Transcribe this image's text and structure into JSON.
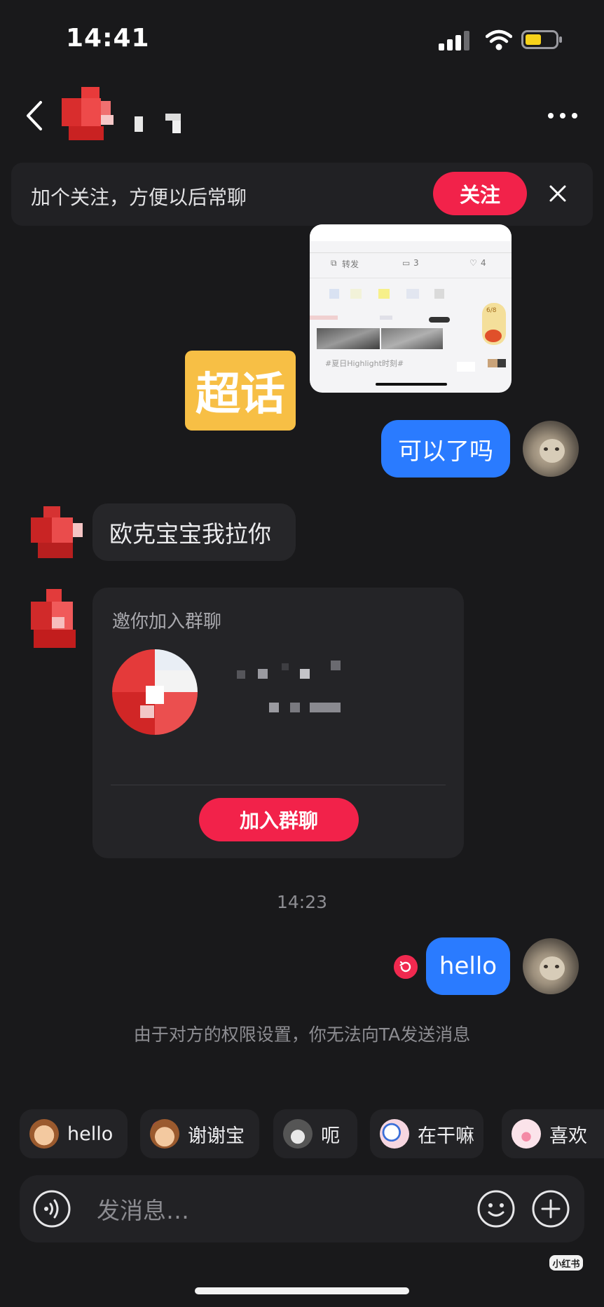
{
  "status_bar": {
    "time": "14:41"
  },
  "follow_banner": {
    "text": "加个关注，方便以后常聊",
    "button_label": "关注"
  },
  "shared_screenshot": {
    "share_label": "转发",
    "comment_count": "3",
    "like_count": "4",
    "page_indicator": "6/8",
    "hashtag": "#夏日Highlight时刻#"
  },
  "sticker": {
    "text": "超话"
  },
  "messages": {
    "outgoing_1": "可以了吗",
    "incoming_1": "欧克宝宝我拉你",
    "outgoing_2": "hello"
  },
  "group_invite": {
    "title": "邀你加入群聊",
    "button_label": "加入群聊"
  },
  "timestamp": "14:23",
  "notice": "由于对方的权限设置，你无法向TA发送消息",
  "quick_replies": [
    {
      "label": "hello",
      "icon": "monkey-face-icon"
    },
    {
      "label": "谢谢宝",
      "icon": "monkey-flower-icon"
    },
    {
      "label": "呃",
      "icon": "cat-face-icon"
    },
    {
      "label": "在干嘛",
      "icon": "magnifier-face-icon"
    },
    {
      "label": "喜欢",
      "icon": "pig-face-icon"
    }
  ],
  "composer": {
    "placeholder": "发消息…"
  },
  "brand_badge": "小红书",
  "colors": {
    "accent_red": "#f2224a",
    "bubble_blue": "#2a7bff",
    "background": "#19191b"
  }
}
